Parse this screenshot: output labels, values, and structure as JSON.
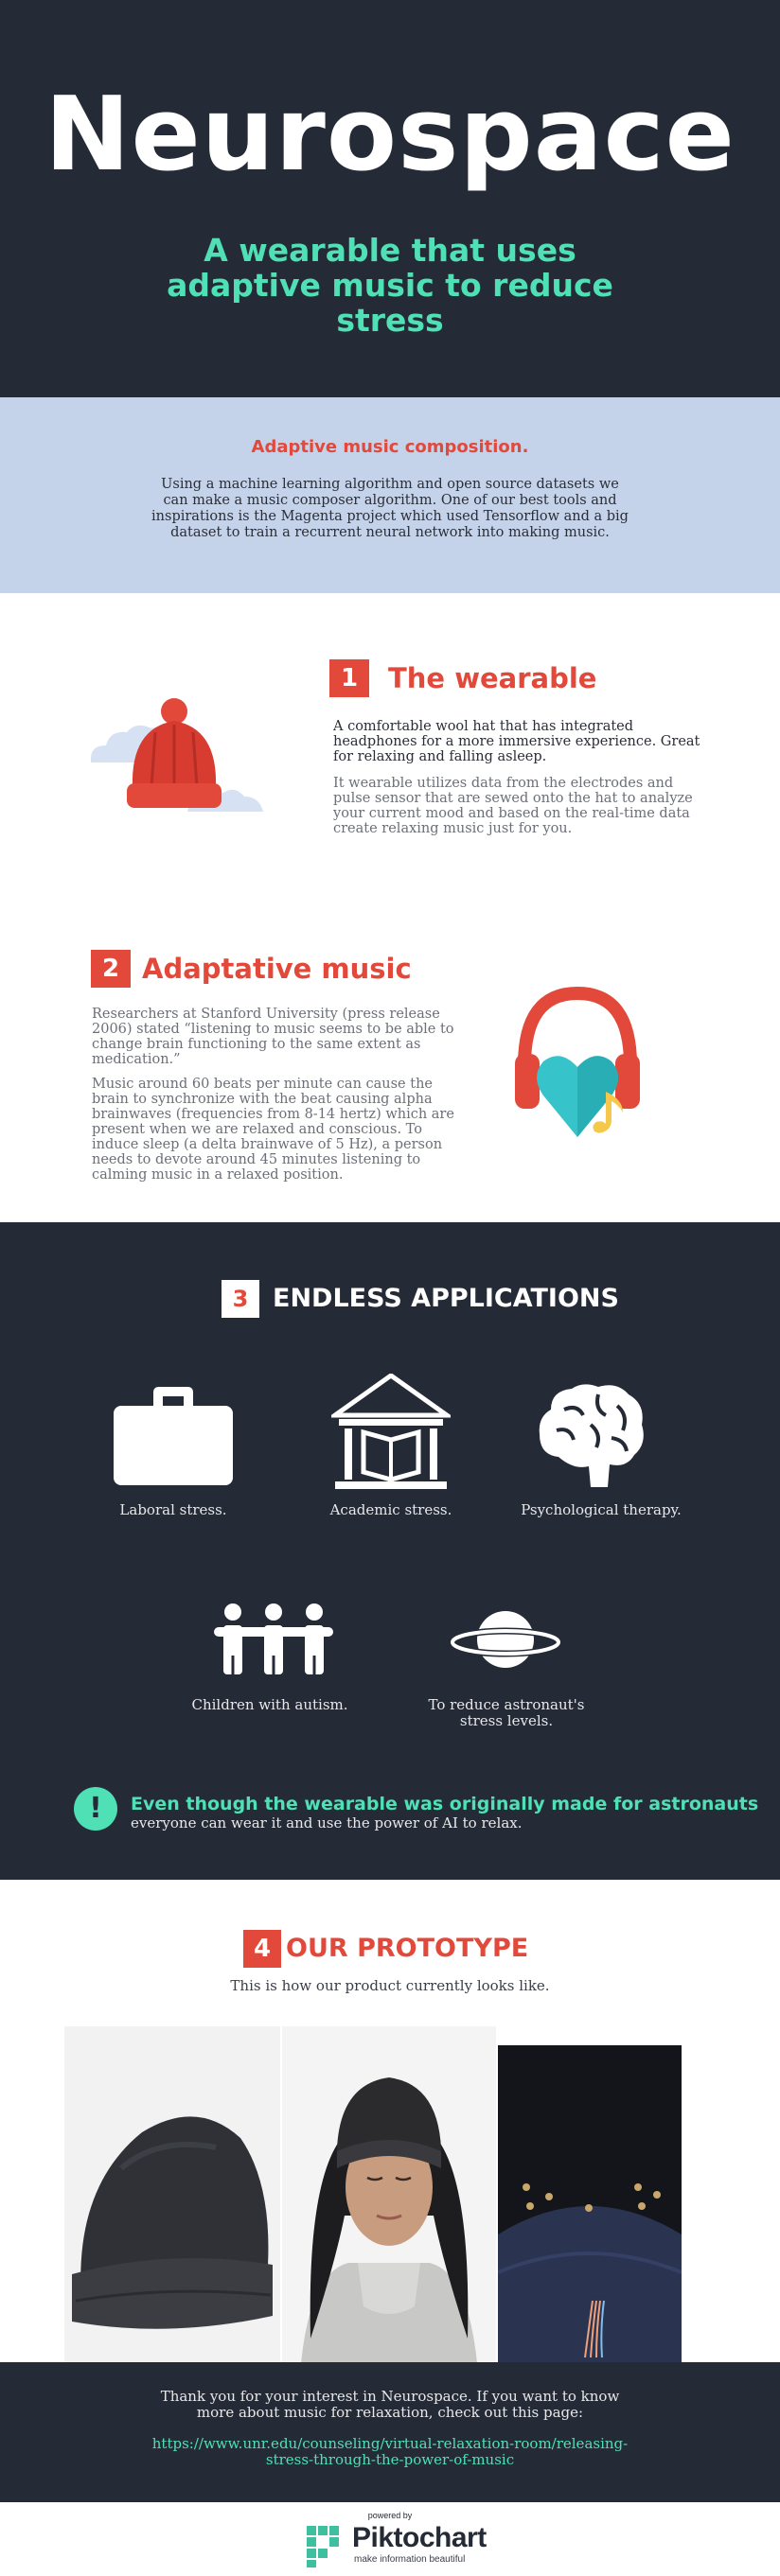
{
  "hero": {
    "title": "Neurospace",
    "subtitle": "A wearable that uses adaptive music to reduce stress"
  },
  "adaptive": {
    "title": "Adaptive music composition.",
    "text": "Using a machine learning algorithm and open source datasets we can make a music composer algorithm. One of our best tools and inspirations is the Magenta project which used Tensorflow and a big dataset to train a recurrent neural network into making music."
  },
  "section1": {
    "number": "1",
    "title": "The wearable",
    "p1": "A comfortable wool hat that has integrated headphones for a more immersive experience. Great for relaxing and falling asleep.",
    "p2": "It wearable utilizes data from the electrodes and pulse sensor that are sewed onto the hat to analyze your current mood and based on the real-time data create relaxing music just for you."
  },
  "section2": {
    "number": "2",
    "title": "Adaptative music",
    "p1": "Researchers at Stanford University (press release 2006) stated “listening to music seems to be able to change brain functioning to the same extent as medication.”",
    "p2": "Music around 60 beats per minute can cause the brain to synchronize with the beat causing alpha brainwaves (frequencies from 8-14 hertz) which are present when we are relaxed and conscious. To induce sleep (a delta brainwave of 5 Hz), a person needs to devote around 45 minutes listening to calming music in a relaxed position."
  },
  "section3": {
    "number": "3",
    "title": "ENDLESS APPLICATIONS",
    "apps": [
      {
        "label": "Laboral stress.",
        "icon": "briefcase-icon"
      },
      {
        "label": "Academic stress.",
        "icon": "academy-building-icon"
      },
      {
        "label": "Psychological therapy.",
        "icon": "brain-icon"
      },
      {
        "label": "Children with autism.",
        "icon": "children-group-icon"
      },
      {
        "label": "To reduce astronaut's stress levels.",
        "icon": "planet-icon"
      }
    ],
    "note_icon": "!",
    "note_bold": "Even though the wearable was originally made for astronauts",
    "note_rest": "everyone can wear it and use the power of AI to relax."
  },
  "section4": {
    "number": "4",
    "title": "OUR PROTOTYPE",
    "subtitle": "This is how our product currently looks like."
  },
  "footer": {
    "text": "Thank you for your interest in Neurospace. If you want to know more about music for relaxation, check out this page:",
    "link": "https://www.unr.edu/counseling/virtual-relaxation-room/releasing-stress-through-the-power-of-music"
  },
  "branding": {
    "powered_by": "powered by",
    "name": "Piktochart",
    "tagline": "make information beautiful"
  },
  "colors": {
    "dark": "#252a37",
    "accent_red": "#e2493b",
    "accent_teal": "#4fe0b5",
    "band_blue": "#c4d2ea"
  }
}
